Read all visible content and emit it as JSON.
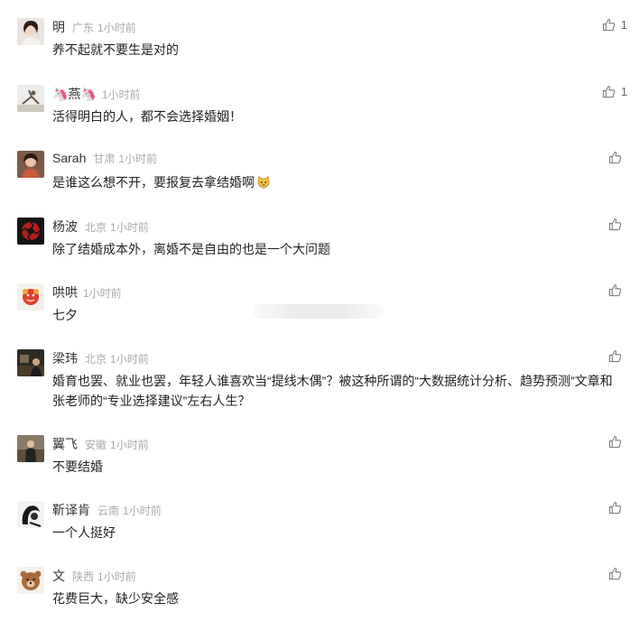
{
  "comments": [
    {
      "name": "明",
      "location": "广东",
      "time": "1小时前",
      "text": "养不起就不要生是对的",
      "likes": "1"
    },
    {
      "name": "🦄燕🦄",
      "location": "",
      "time": "1小时前",
      "text": "活得明白的人，都不会选择婚姻！",
      "likes": "1"
    },
    {
      "name": "Sarah",
      "location": "甘肃",
      "time": "1小时前",
      "text": "是谁这么想不开，要报复去拿结婚啊",
      "likes": ""
    },
    {
      "name": "杨波",
      "location": "北京",
      "time": "1小时前",
      "text": "除了结婚成本外，离婚不是自由的也是一个大问题",
      "likes": ""
    },
    {
      "name": "哄哄",
      "location": "",
      "time": "1小时前",
      "text": "七夕",
      "likes": ""
    },
    {
      "name": "梁玮",
      "location": "北京",
      "time": "1小时前",
      "text": "婚育也罢、就业也罢，年轻人谁喜欢当“提线木偶”？被这种所谓的“大数据统计分析、趋势预测”文章和张老师的“专业选择建议”左右人生？",
      "likes": ""
    },
    {
      "name": "翼飞",
      "location": "安徽",
      "time": "1小时前",
      "text": "不要结婚",
      "likes": ""
    },
    {
      "name": "靳译肯",
      "location": "云南",
      "time": "1小时前",
      "text": "一个人挺好",
      "likes": ""
    },
    {
      "name": "文",
      "location": "陕西",
      "time": "1小时前",
      "text": "花费巨大，缺少安全感",
      "likes": ""
    }
  ],
  "icons": {
    "like": "thumbs-up-icon",
    "emoji": "cat-face-emoji-icon"
  },
  "colors": {
    "name": "#333333",
    "meta": "#aaaaaa",
    "text": "#222222"
  }
}
